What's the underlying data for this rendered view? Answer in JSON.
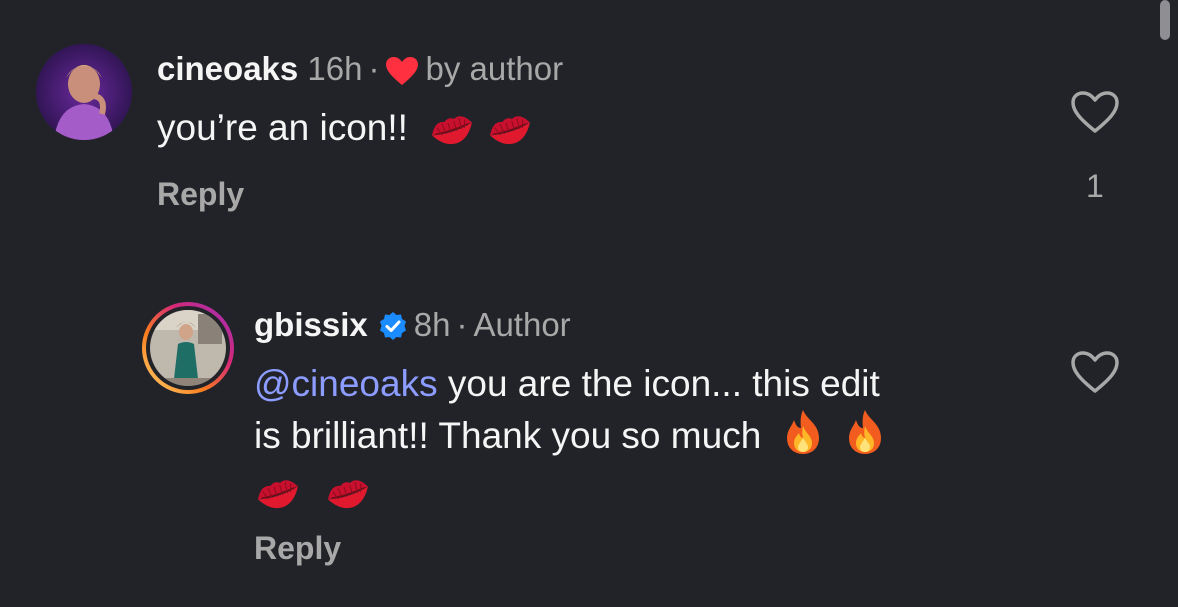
{
  "comments": [
    {
      "username": "cineoaks",
      "time": "16h",
      "dot": "·",
      "liked_by": "by author",
      "body": "you’re an icon!!",
      "body_emoji": [
        "kiss-mark",
        "kiss-mark"
      ],
      "reply_label": "Reply",
      "like_count": "1"
    },
    {
      "username": "gbissix",
      "time": "8h",
      "dot": "·",
      "role": "Author",
      "mention": "@cineoaks",
      "body_line1": " you are the icon... this edit",
      "body_line2": "is brilliant!! Thank you so much",
      "body_emoji_line2": [
        "fire",
        "fire"
      ],
      "body_emoji_line3": [
        "kiss-mark",
        "kiss-mark"
      ],
      "reply_label": "Reply"
    }
  ],
  "colors": {
    "background": "#222329",
    "mention": "#8c9dff",
    "verified": "#1a8cff",
    "heart_red": "#ff3040",
    "muted": "#a8a8a8"
  }
}
